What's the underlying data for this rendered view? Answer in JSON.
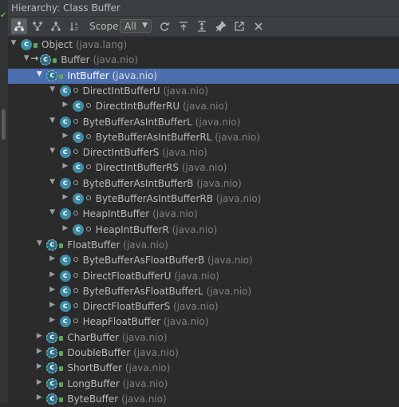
{
  "window": {
    "title": "Hierarchy:  Class Buffer"
  },
  "toolbar": {
    "scope_label": "Scope:",
    "scope_value": "All",
    "buttons": [
      "class-hierarchy",
      "supertypes",
      "subtypes",
      "sort-alphabetically",
      "refresh",
      "export",
      "expand-all",
      "pin",
      "open-in-window",
      "close"
    ]
  },
  "tree": [
    {
      "name": "Object",
      "pkg": "(java.lang)",
      "depth": 0,
      "expanded": true,
      "abstract": false,
      "access": "public"
    },
    {
      "name": "Buffer",
      "pkg": "(java.nio)",
      "depth": 1,
      "expanded": true,
      "abstract": true,
      "access": "public",
      "focus": true
    },
    {
      "name": "IntBuffer",
      "pkg": "(java.nio)",
      "depth": 2,
      "expanded": true,
      "abstract": true,
      "access": "public",
      "selected": true
    },
    {
      "name": "DirectIntBufferU",
      "pkg": "(java.nio)",
      "depth": 3,
      "expanded": true,
      "abstract": false,
      "access": "package"
    },
    {
      "name": "DirectIntBufferRU",
      "pkg": "(java.nio)",
      "depth": 4,
      "expanded": false,
      "abstract": false,
      "access": "package"
    },
    {
      "name": "ByteBufferAsIntBufferL",
      "pkg": "(java.nio)",
      "depth": 3,
      "expanded": true,
      "abstract": false,
      "access": "package"
    },
    {
      "name": "ByteBufferAsIntBufferRL",
      "pkg": "(java.nio)",
      "depth": 4,
      "expanded": false,
      "abstract": false,
      "access": "package"
    },
    {
      "name": "DirectIntBufferS",
      "pkg": "(java.nio)",
      "depth": 3,
      "expanded": true,
      "abstract": false,
      "access": "package"
    },
    {
      "name": "DirectIntBufferRS",
      "pkg": "(java.nio)",
      "depth": 4,
      "expanded": false,
      "abstract": false,
      "access": "package"
    },
    {
      "name": "ByteBufferAsIntBufferB",
      "pkg": "(java.nio)",
      "depth": 3,
      "expanded": true,
      "abstract": false,
      "access": "package"
    },
    {
      "name": "ByteBufferAsIntBufferRB",
      "pkg": "(java.nio)",
      "depth": 4,
      "expanded": false,
      "abstract": false,
      "access": "package"
    },
    {
      "name": "HeapIntBuffer",
      "pkg": "(java.nio)",
      "depth": 3,
      "expanded": true,
      "abstract": false,
      "access": "package"
    },
    {
      "name": "HeapIntBufferR",
      "pkg": "(java.nio)",
      "depth": 4,
      "expanded": false,
      "abstract": false,
      "access": "package"
    },
    {
      "name": "FloatBuffer",
      "pkg": "(java.nio)",
      "depth": 2,
      "expanded": true,
      "abstract": true,
      "access": "public"
    },
    {
      "name": "ByteBufferAsFloatBufferB",
      "pkg": "(java.nio)",
      "depth": 3,
      "expanded": false,
      "abstract": false,
      "access": "package"
    },
    {
      "name": "DirectFloatBufferU",
      "pkg": "(java.nio)",
      "depth": 3,
      "expanded": false,
      "abstract": false,
      "access": "package"
    },
    {
      "name": "ByteBufferAsFloatBufferL",
      "pkg": "(java.nio)",
      "depth": 3,
      "expanded": false,
      "abstract": false,
      "access": "package"
    },
    {
      "name": "DirectFloatBufferS",
      "pkg": "(java.nio)",
      "depth": 3,
      "expanded": false,
      "abstract": false,
      "access": "package"
    },
    {
      "name": "HeapFloatBuffer",
      "pkg": "(java.nio)",
      "depth": 3,
      "expanded": false,
      "abstract": false,
      "access": "package"
    },
    {
      "name": "CharBuffer",
      "pkg": "(java.nio)",
      "depth": 2,
      "expanded": false,
      "abstract": true,
      "access": "public"
    },
    {
      "name": "DoubleBuffer",
      "pkg": "(java.nio)",
      "depth": 2,
      "expanded": false,
      "abstract": true,
      "access": "public"
    },
    {
      "name": "ShortBuffer",
      "pkg": "(java.nio)",
      "depth": 2,
      "expanded": false,
      "abstract": true,
      "access": "public"
    },
    {
      "name": "LongBuffer",
      "pkg": "(java.nio)",
      "depth": 2,
      "expanded": false,
      "abstract": true,
      "access": "public"
    },
    {
      "name": "ByteBuffer",
      "pkg": "(java.nio)",
      "depth": 2,
      "expanded": false,
      "abstract": true,
      "access": "public"
    }
  ],
  "colors": {
    "background": "#2b2b2b",
    "selection": "#4b6eaf",
    "class_icon": "#3f8ba6",
    "access_public": "#5fa55a"
  }
}
